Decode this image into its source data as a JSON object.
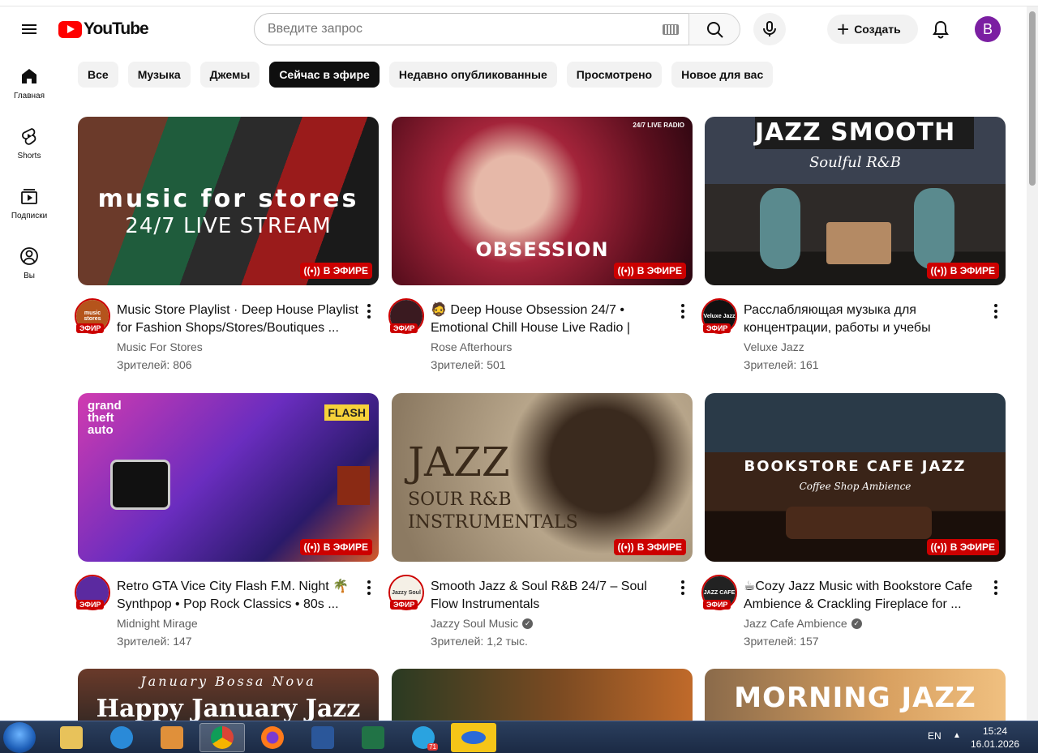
{
  "header": {
    "logo_text": "YouTube",
    "search_placeholder": "Введите запрос",
    "create_label": "Создать",
    "avatar_letter": "В"
  },
  "sidebar": {
    "items": [
      {
        "label": "Главная",
        "icon": "home-icon"
      },
      {
        "label": "Shorts",
        "icon": "shorts-icon"
      },
      {
        "label": "Подписки",
        "icon": "subscriptions-icon"
      },
      {
        "label": "Вы",
        "icon": "you-icon"
      }
    ]
  },
  "chips": [
    "Все",
    "Музыка",
    "Джемы",
    "Сейчас в эфире",
    "Недавно опубликованные",
    "Просмотрено",
    "Новое для вас"
  ],
  "active_chip": "Сейчас в эфире",
  "live_label": "В ЭФИРЕ",
  "efir_label": "ЭФИР",
  "videos": [
    {
      "title": "Music Store Playlist · Deep House Playlist for Fashion Shops/Stores/Boutiques ...",
      "channel": "Music For Stores",
      "views": "Зрителей: 806",
      "thumb_text": "music for stores",
      "thumb_sub": "24/7 LIVE STREAM",
      "verified": false,
      "avatar_text": "music stores"
    },
    {
      "title": "🧔 Deep House Obsession 24/7 • Emotional Chill House Live Radio | Rose...",
      "channel": "Rose Afterhours",
      "views": "Зрителей: 501",
      "thumb_text": "OBSESSION",
      "thumb_sub": "24/7 LIVE RADIO",
      "verified": false,
      "avatar_text": ""
    },
    {
      "title": "Расслабляющая музыка для концентрации, работы и учебы",
      "channel": "Veluxe Jazz",
      "views": "Зрителей: 161",
      "thumb_text": "JAZZ SMOOTH",
      "thumb_sub": "Soulful R&B",
      "verified": false,
      "avatar_text": "Veluxe Jazz"
    },
    {
      "title": "Retro GTA Vice City Flash F.M. Night 🌴 Synthpop • Pop Rock Classics • 80s ...",
      "channel": "Midnight Mirage",
      "views": "Зрителей: 147",
      "thumb_text": "grand theft auto",
      "thumb_sub": "FLASH",
      "verified": false,
      "avatar_text": ""
    },
    {
      "title": "Smooth Jazz & Soul R&B 24/7 – Soul Flow Instrumentals",
      "channel": "Jazzy Soul Music",
      "views": "Зрителей: 1,2 тыс.",
      "thumb_text": "JAZZ",
      "thumb_sub": "SOUR R&B INSTRUMENTALS",
      "verified": true,
      "avatar_text": "Jazzy Soul"
    },
    {
      "title": "☕Cozy Jazz Music with Bookstore Cafe Ambience & Crackling Fireplace for ...",
      "channel": "Jazz Cafe Ambience",
      "views": "Зрителей: 157",
      "thumb_text": "BOOKSTORE CAFE JAZZ",
      "thumb_sub": "Coffee Shop Ambience",
      "verified": true,
      "avatar_text": "JAZZ CAFE"
    },
    {
      "title": "",
      "channel": "",
      "views": "",
      "thumb_text": "Happy January Jazz",
      "thumb_sub": "January Bossa Nova",
      "verified": false,
      "avatar_text": ""
    },
    {
      "title": "",
      "channel": "",
      "views": "",
      "thumb_text": "",
      "thumb_sub": "",
      "verified": false,
      "avatar_text": ""
    },
    {
      "title": "",
      "channel": "",
      "views": "",
      "thumb_text": "MORNING JAZZ",
      "thumb_sub": "",
      "verified": false,
      "avatar_text": ""
    }
  ],
  "taskbar": {
    "lang": "EN",
    "time": "15:24",
    "date": "16.01.2026",
    "telegram_badge": "71"
  }
}
